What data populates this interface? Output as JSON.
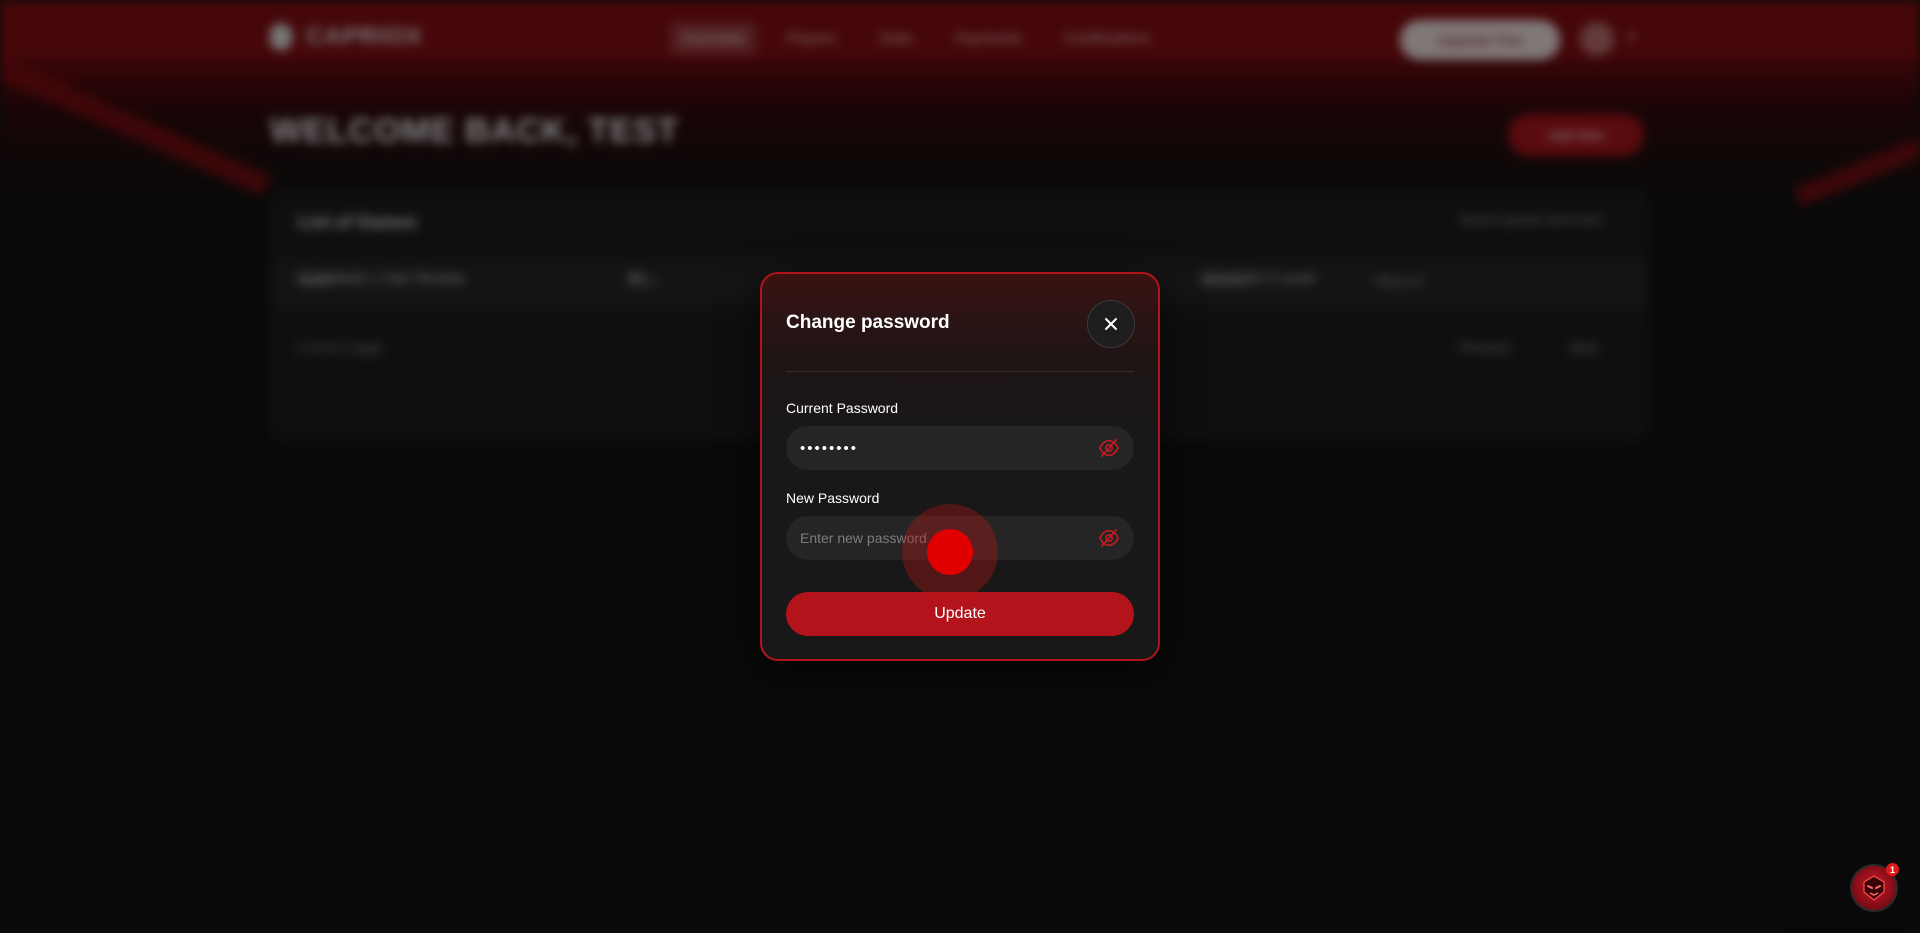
{
  "background": {
    "logo_text": "CAPRIOX",
    "nav": [
      "Overview",
      "Players",
      "Stats",
      "Payments",
      "Certifications"
    ],
    "header_pill": "Upgrade Plan",
    "page_title": "WELCOME BACK, TEST",
    "add_button": "Add New",
    "card_title": "List of Games",
    "card_search": "Search games and more",
    "table_headers": [
      "Name",
      "Price",
      "Created",
      "Updated"
    ],
    "row": [
      "Battlefield 1 Clan Review",
      "$0",
      "SEASON 2 Level",
      "—"
    ],
    "footer_left": "1-10 of 1 page",
    "footer_right": [
      "Previous",
      "Next"
    ]
  },
  "modal": {
    "title": "Change password",
    "current_password": {
      "label": "Current Password",
      "value": "password"
    },
    "new_password": {
      "label": "New Password",
      "value": "",
      "placeholder": "Enter new password"
    },
    "submit_label": "Update"
  },
  "assistant": {
    "badge": "1"
  },
  "colors": {
    "accent": "#b3141c",
    "header_red": "#7e0d12",
    "surface": "#181818",
    "input_bg": "#252525"
  },
  "icons": {
    "close": "close-icon",
    "toggle_visibility": "eye-off-icon",
    "assistant": "assistant-mascot-icon"
  }
}
